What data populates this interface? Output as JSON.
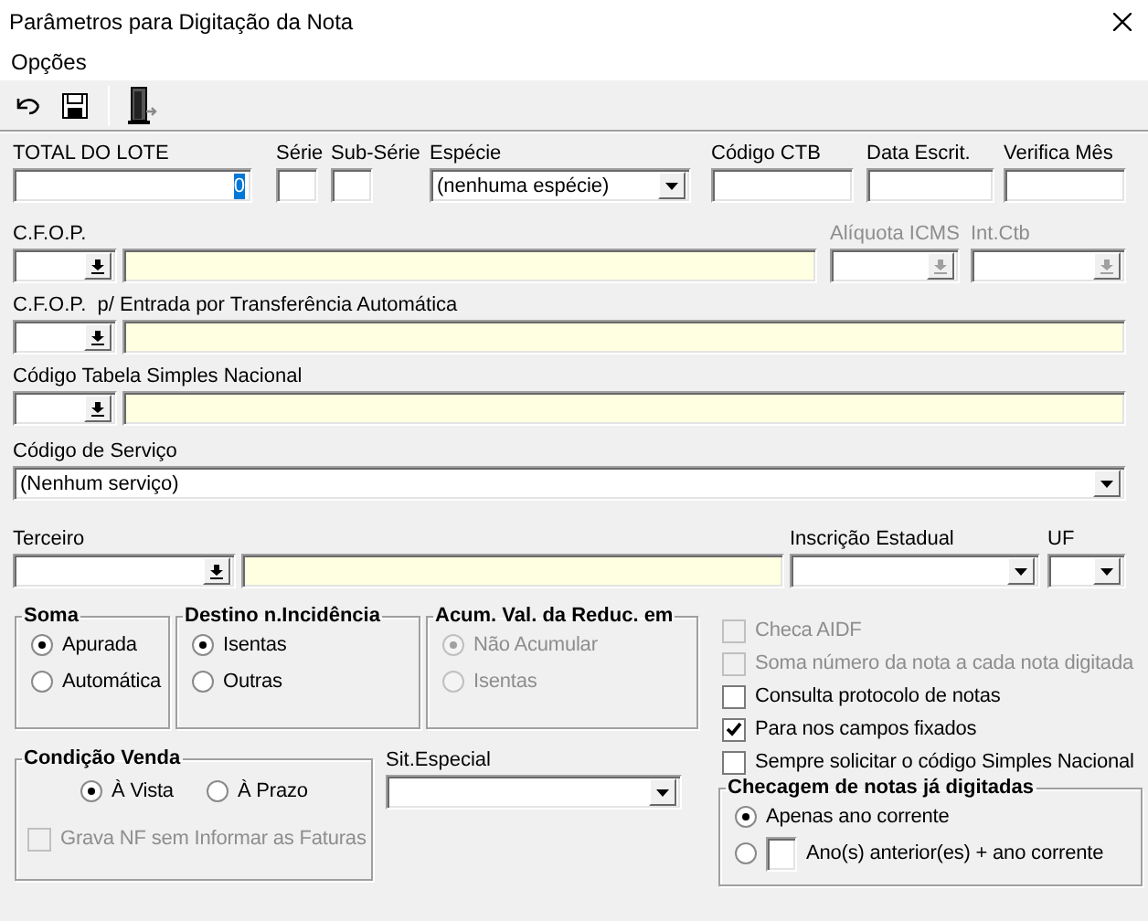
{
  "window": {
    "title": "Parâmetros para Digitação da Nota"
  },
  "menu": [
    "Opções"
  ],
  "top_fields": [
    {
      "label": "TOTAL DO LOTE",
      "kind": "text",
      "value": "0"
    },
    {
      "label": "Série",
      "kind": "text"
    },
    {
      "label": "Sub-Série",
      "kind": "text"
    },
    {
      "label": "Espécie",
      "kind": "dropdown",
      "value": "(nenhuma espécie)"
    },
    {
      "label": "Código CTB",
      "kind": "text"
    },
    {
      "label": "Data Escrit.",
      "kind": "text"
    },
    {
      "label": "Verifica Mês",
      "kind": "text"
    }
  ],
  "cfop": {
    "label": "C.F.O.P."
  },
  "aliquota_icms": {
    "label": "Alíquota ICMS",
    "disabled": true
  },
  "int_ctb": {
    "label": "Int.Ctb",
    "disabled": true
  },
  "cfop_transferencia": {
    "label": "C.F.O.P.  p/ Entrada por Transferência Automática"
  },
  "codigo_simples": {
    "label": "Código Tabela Simples Nacional"
  },
  "codigo_servico": {
    "label": "Código de Serviço",
    "value": "(Nenhum serviço)"
  },
  "terceiro": {
    "label": "Terceiro"
  },
  "inscricao_estadual": {
    "label": "Inscrição Estadual"
  },
  "uf": {
    "label": "UF"
  },
  "soma": {
    "title": "Soma",
    "disabled": false,
    "options": [
      {
        "label": "Apurada",
        "selected": true
      },
      {
        "label": "Automática",
        "selected": false
      }
    ]
  },
  "destino": {
    "title": "Destino n.Incidência",
    "disabled": false,
    "options": [
      {
        "label": "Isentas",
        "selected": true
      },
      {
        "label": "Outras",
        "selected": false
      }
    ]
  },
  "acumulacao": {
    "title": "Acum. Val. da Reduc. em",
    "disabled": true,
    "options": [
      {
        "label": "Não Acumular",
        "selected": true
      },
      {
        "label": "Isentas",
        "selected": false
      }
    ]
  },
  "checks": [
    {
      "label": "Checa AIDF",
      "checked": false,
      "disabled": true
    },
    {
      "label": "Soma número da nota a cada nota digitada",
      "checked": false,
      "disabled": true
    },
    {
      "label": "Consulta protocolo de notas",
      "checked": false,
      "disabled": false
    },
    {
      "label": "Para nos campos fixados",
      "checked": true,
      "disabled": false
    },
    {
      "label": "Sempre solicitar o código Simples Nacional",
      "checked": false,
      "disabled": false
    }
  ],
  "condicao_venda": {
    "title": "Condição Venda",
    "options": [
      {
        "label": "À Vista",
        "selected": true
      },
      {
        "label": "À Prazo",
        "selected": false
      }
    ],
    "grava": {
      "label": "Grava NF sem Informar as Faturas",
      "checked": false,
      "disabled": true
    }
  },
  "sit_especial": {
    "label": "Sit.Especial"
  },
  "checagem": {
    "title": "Checagem de notas já digitadas",
    "options": [
      {
        "label": "Apenas ano corrente",
        "selected": true,
        "kind": "plain"
      },
      {
        "label": "Ano(s) anterior(es) + ano corrente",
        "selected": false,
        "kind": "with_input"
      }
    ]
  }
}
